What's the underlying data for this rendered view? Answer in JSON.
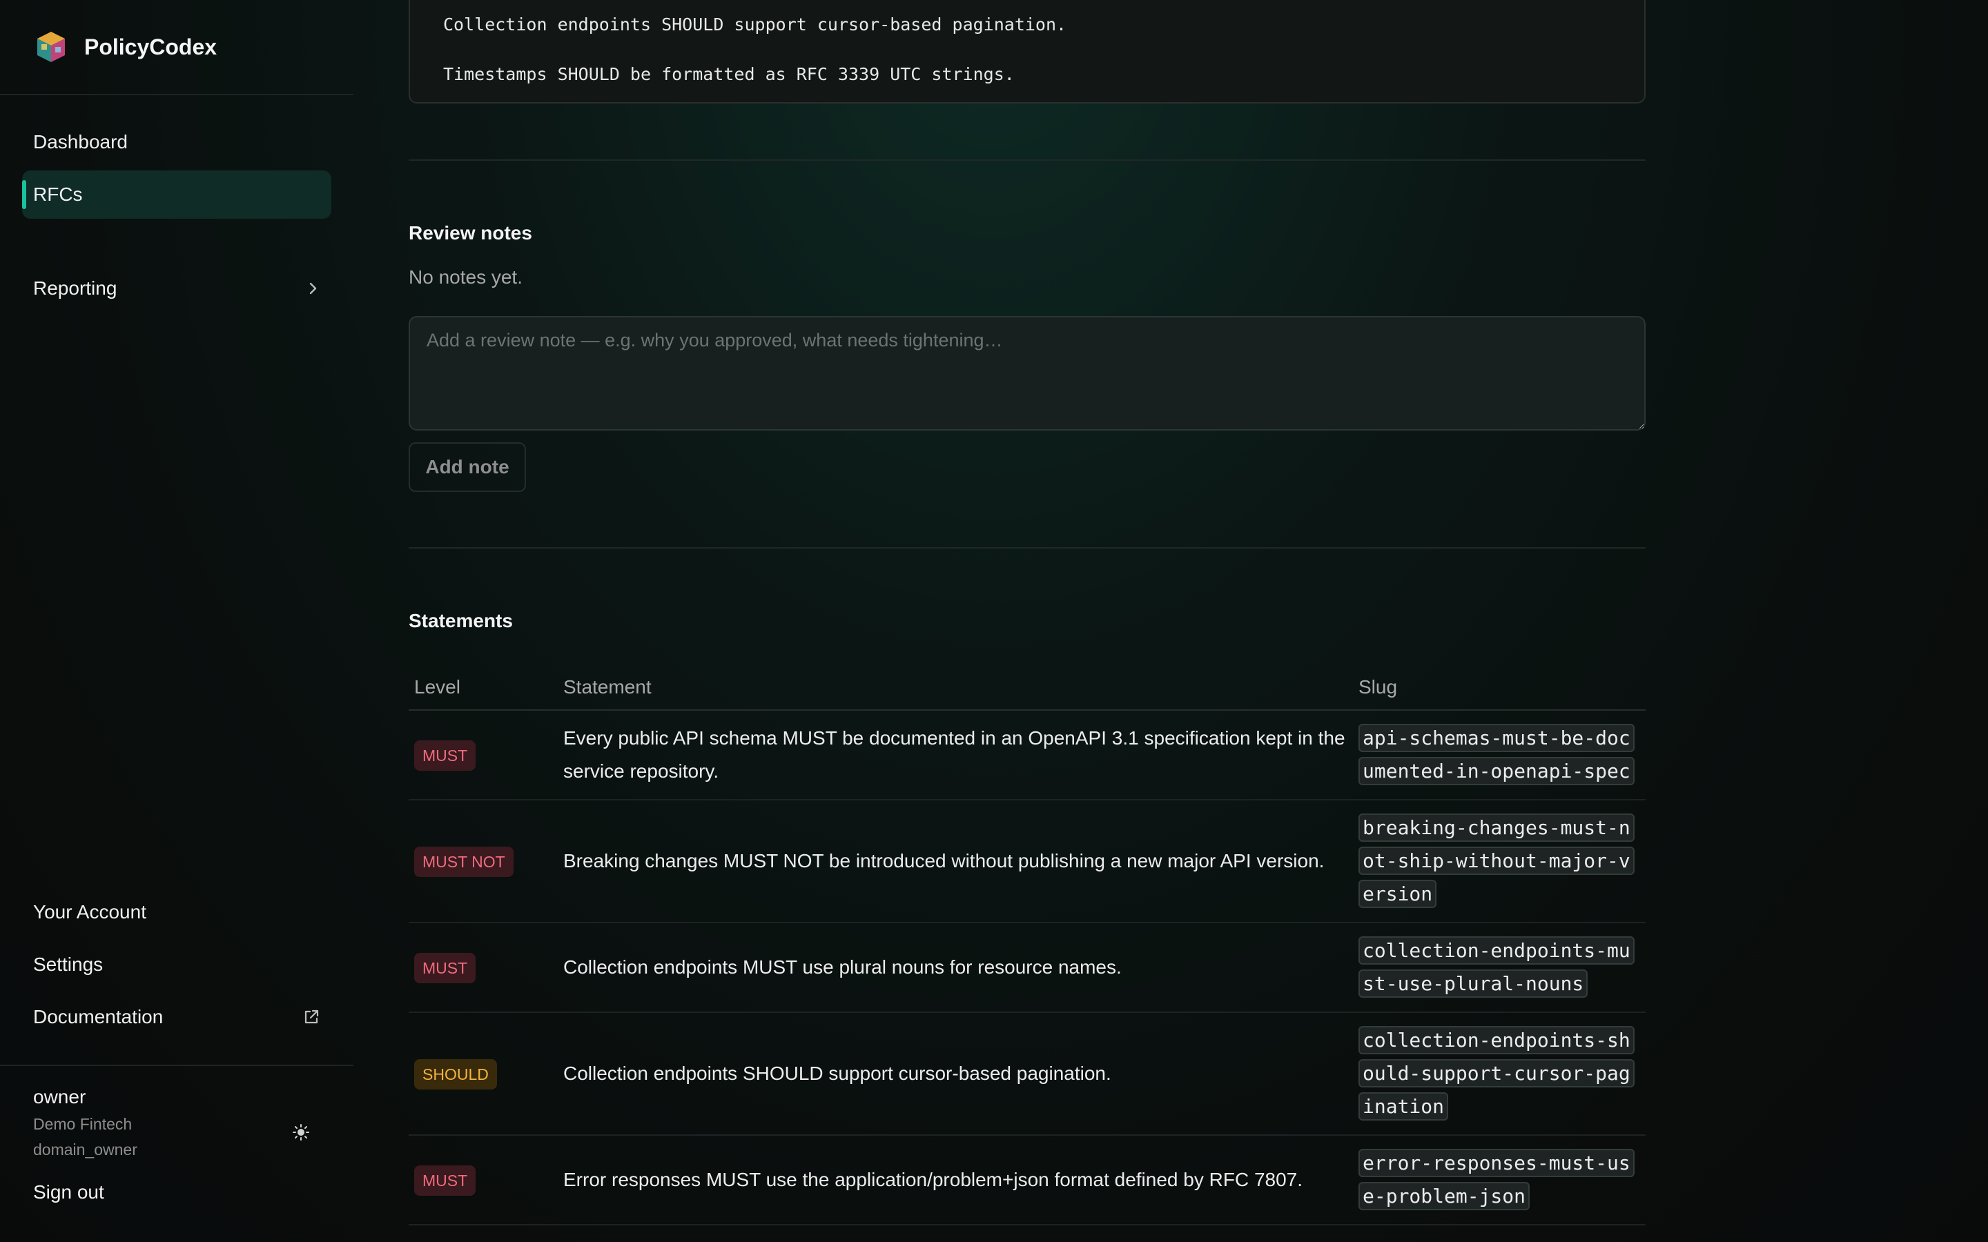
{
  "app": {
    "name": "PolicyCodex"
  },
  "sidebar": {
    "nav": [
      {
        "label": "Dashboard"
      },
      {
        "label": "RFCs"
      },
      {
        "label": "Reporting"
      }
    ],
    "bottom": [
      {
        "label": "Your Account"
      },
      {
        "label": "Settings"
      },
      {
        "label": "Documentation"
      }
    ],
    "user": {
      "name": "owner",
      "org": "Demo Fintech",
      "role": "domain_owner"
    },
    "signout": "Sign out"
  },
  "spec": {
    "lines": [
      "Collection endpoints SHOULD support cursor-based pagination.",
      "Timestamps SHOULD be formatted as RFC 3339 UTC strings."
    ]
  },
  "review": {
    "title": "Review notes",
    "empty": "No notes yet.",
    "placeholder": "Add a review note — e.g. why you approved, what needs tightening…",
    "button": "Add note"
  },
  "statements": {
    "title": "Statements",
    "columns": [
      "Level",
      "Statement",
      "Slug"
    ],
    "rows": [
      {
        "level": "MUST",
        "statement": "Every public API schema MUST be documented in an OpenAPI 3.1 specification kept in the service repository.",
        "slug": "api-schemas-must-be-documented-in-openapi-spec"
      },
      {
        "level": "MUST NOT",
        "statement": "Breaking changes MUST NOT be introduced without publishing a new major API version.",
        "slug": "breaking-changes-must-not-ship-without-major-version"
      },
      {
        "level": "MUST",
        "statement": "Collection endpoints MUST use plural nouns for resource names.",
        "slug": "collection-endpoints-must-use-plural-nouns"
      },
      {
        "level": "SHOULD",
        "statement": "Collection endpoints SHOULD support cursor-based pagination.",
        "slug": "collection-endpoints-should-support-cursor-pagination"
      },
      {
        "level": "MUST",
        "statement": "Error responses MUST use the application/problem+json format defined by RFC 7807.",
        "slug": "error-responses-must-use-problem-json"
      }
    ]
  },
  "colors": {
    "accent": "#19c39b",
    "must": "#f06b7d",
    "should": "#f2b43b"
  }
}
